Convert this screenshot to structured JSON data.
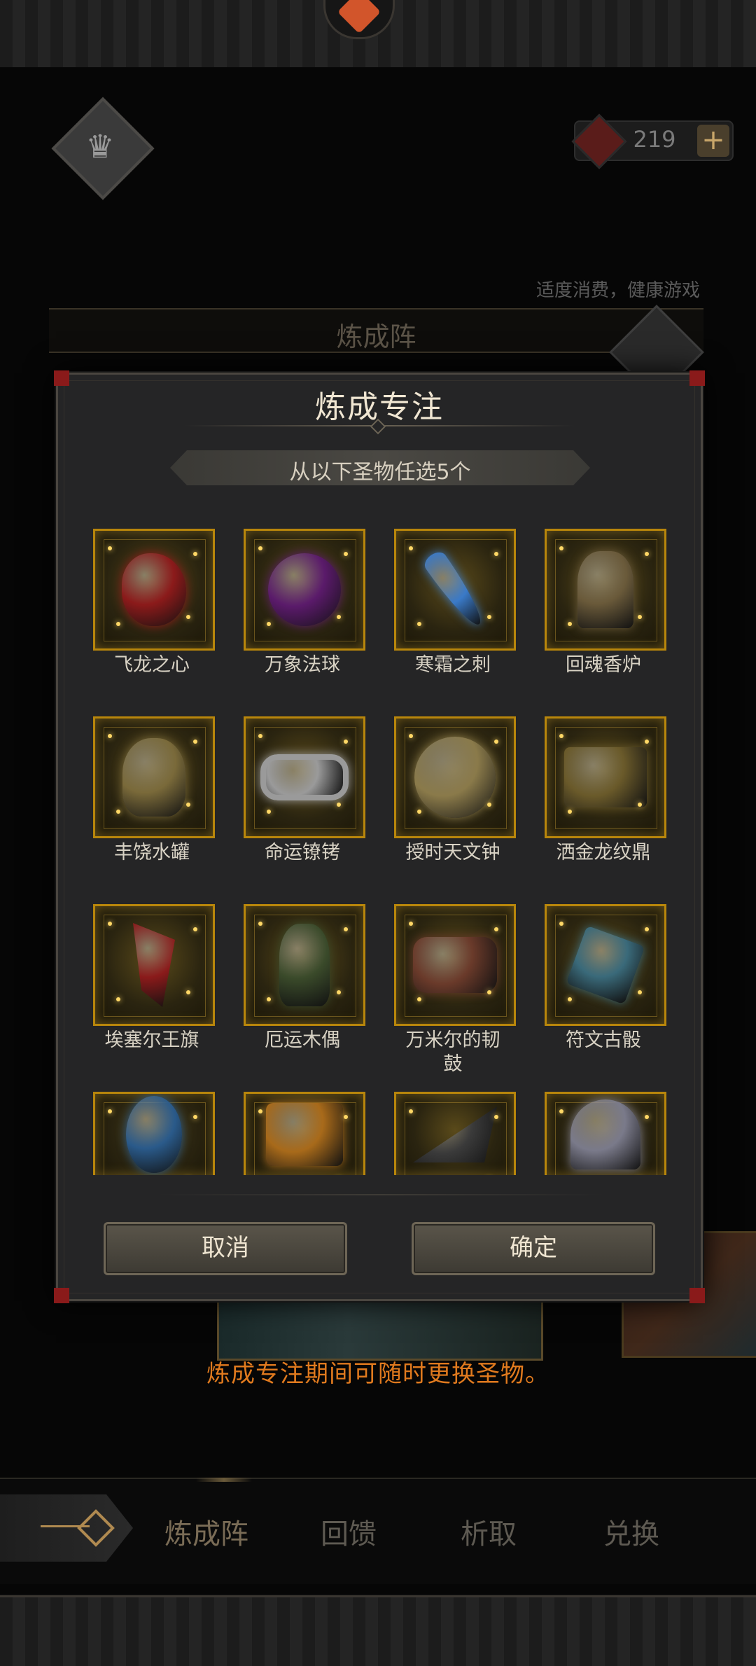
{
  "status_bar": {
    "currency_value": "219",
    "currency_plus": "+",
    "disclaimer": "适度消费，健康游戏"
  },
  "background": {
    "panel_title": "炼成阵",
    "hint": "炼成专注期间可随时更换圣物。"
  },
  "dialog": {
    "title": "炼成专注",
    "subtitle": "从以下圣物任选5个",
    "relics": [
      {
        "name": "飞龙之心",
        "icon": "dragon-heart-icon",
        "color": "#8b1a1a"
      },
      {
        "name": "万象法球",
        "icon": "arcane-orb-icon",
        "color": "#5a1a6a"
      },
      {
        "name": "寒霜之刺",
        "icon": "frost-thorn-icon",
        "color": "#3a7ac8"
      },
      {
        "name": "回魂香炉",
        "icon": "soul-censer-icon",
        "color": "#6a5a3a"
      },
      {
        "name": "丰饶水罐",
        "icon": "abundance-jar-icon",
        "color": "#7a6a3a"
      },
      {
        "name": "命运镣铐",
        "icon": "fate-shackles-icon",
        "color": "#9a9a9a"
      },
      {
        "name": "授时天文钟",
        "icon": "astronomical-clock-icon",
        "color": "#8a7a4a"
      },
      {
        "name": "洒金龙纹鼎",
        "icon": "dragon-cauldron-icon",
        "color": "#6a5a2a"
      },
      {
        "name": "埃塞尔王旗",
        "icon": "royal-banner-icon",
        "color": "#8a1a1a"
      },
      {
        "name": "厄运木偶",
        "icon": "doom-puppet-icon",
        "color": "#3a4a2a"
      },
      {
        "name": "万米尔的韧鼓",
        "icon": "war-drum-icon",
        "color": "#6a3a2a"
      },
      {
        "name": "符文古骰",
        "icon": "rune-dice-icon",
        "color": "#3a6a7a"
      },
      {
        "name": "",
        "icon": "crystal-flask-icon",
        "color": "#2a5a8a"
      },
      {
        "name": "",
        "icon": "ancient-scroll-icon",
        "color": "#a86a1a"
      },
      {
        "name": "",
        "icon": "shadow-wing-icon",
        "color": "#3a3a3a"
      },
      {
        "name": "",
        "icon": "silver-chalice-icon",
        "color": "#7a7a8a"
      }
    ],
    "cancel_label": "取消",
    "confirm_label": "确定"
  },
  "nav": {
    "items": [
      "炼成阵",
      "回馈",
      "析取",
      "兑换"
    ]
  },
  "colors": {
    "accent_gold": "#b8860b",
    "hint_orange": "#e07a1e",
    "corner_red": "#8a1a1a"
  }
}
